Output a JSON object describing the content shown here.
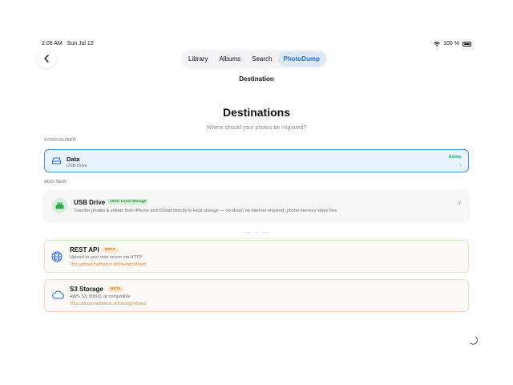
{
  "status_bar": {
    "time": "2:09 AM",
    "date": "Sun Jul 12",
    "battery": "100 %",
    "wifi_icon": "wifi-icon",
    "battery_icon": "battery-icon"
  },
  "nav": {
    "back_icon": "chevron-left-icon"
  },
  "tabs": [
    {
      "label": "Library",
      "active": false
    },
    {
      "label": "Albums",
      "active": false
    },
    {
      "label": "Search",
      "active": false
    },
    {
      "label": "PhotoDump",
      "active": true
    }
  ],
  "header": {
    "subtitle": "Destination",
    "title": "Destinations",
    "prompt": "Where should your photos be migrated?"
  },
  "configured": {
    "section_label": "CONFIGURED",
    "item": {
      "name": "Data",
      "type": "USB Drive",
      "status": "Active",
      "icon": "drive-icon"
    }
  },
  "add_new": {
    "section_label": "ADD NEW",
    "usb": {
      "name": "USB Drive",
      "badge": "100% Local Storage",
      "description": "Transfer photos & videos from iPhone and iCloud directly to local storage — no cloud, no internet required, phone memory stays free",
      "icon": "usb-drive-icon"
    },
    "divider_label": "or",
    "rest_api": {
      "name": "REST API",
      "badge": "BETA",
      "description": "Upload to your own server via HTTP",
      "warning": "This upload method is still being refined",
      "icon": "globe-icon"
    },
    "s3": {
      "name": "S3 Storage",
      "badge": "BETA",
      "description": "AWS S3, MinIO, or compatible",
      "warning": "This upload method is still being refined",
      "icon": "cloud-icon"
    }
  },
  "colors": {
    "accent": "#2b6ed8",
    "active_green": "#34a853",
    "beta_orange": "#e5812b",
    "configured_border": "#3b95e6"
  }
}
